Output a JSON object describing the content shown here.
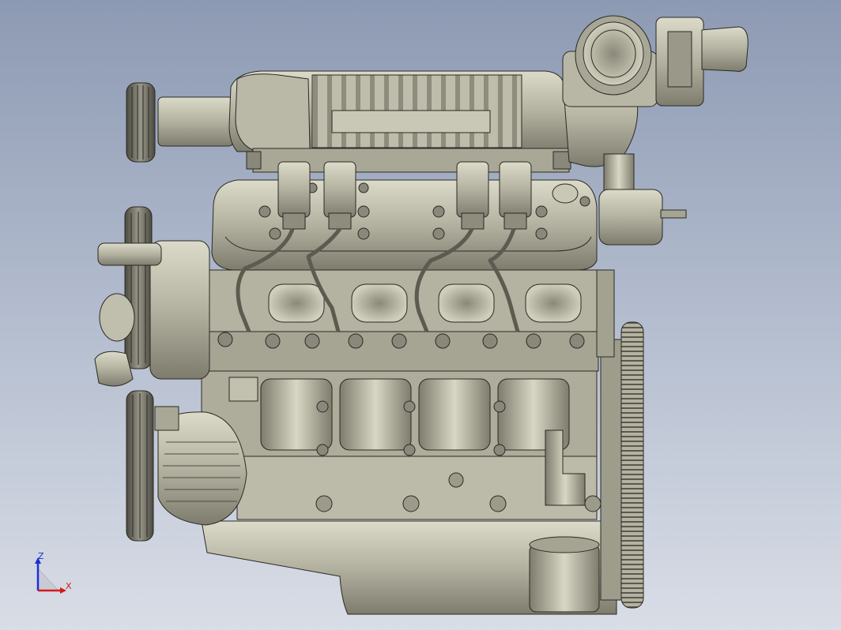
{
  "scene": {
    "subject": "supercharged-v8-engine-cad-model",
    "render_style": "shaded-with-edges",
    "colors": {
      "background_top": "#8d9ab3",
      "background_bottom": "#d9dde6",
      "metal_light": "#c9c7b5",
      "metal_mid": "#a9a795",
      "metal_dark": "#6f6d60",
      "edge_line": "#2a2a24"
    }
  },
  "triad": {
    "z_label": "Z",
    "x_label": "X",
    "z_color": "#1a2fd6",
    "x_color": "#d61a1a"
  }
}
